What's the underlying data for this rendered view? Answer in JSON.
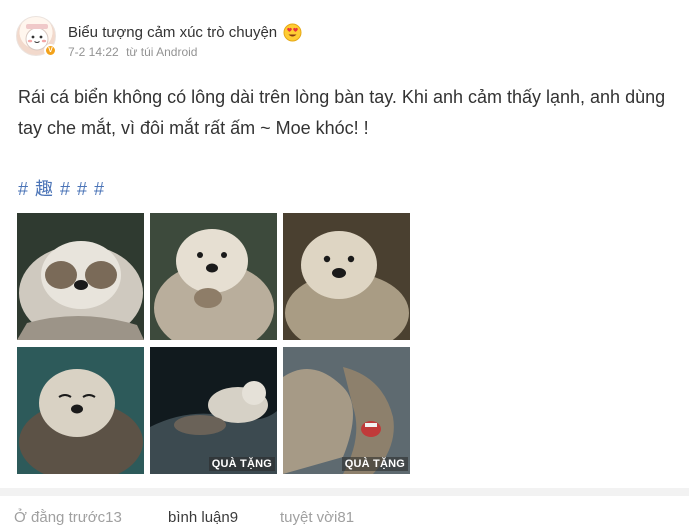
{
  "author": {
    "name": "Biểu tượng cảm xúc trò chuyện",
    "badge_icon": "heart-eyes-emoji-icon",
    "verified_icon": "verified-v-icon",
    "verified_color": "#f3a21a"
  },
  "meta": {
    "time": "7-2 14:22",
    "source": "từ túi Android"
  },
  "content": {
    "text": "Rái cá biển không có lông dài trên lòng bàn tay. Khi anh cảm thấy lạnh, anh dùng tay che mắt, vì đôi mắt rất ấm ~ Moe khóc! !",
    "hashtag": "# 趣 # # #",
    "hashtag_color": "#4b74b7"
  },
  "images": [
    {
      "name": "otter-covering-eyes",
      "badge": ""
    },
    {
      "name": "otter-paws-together",
      "badge": ""
    },
    {
      "name": "otter-looking-up",
      "badge": ""
    },
    {
      "name": "otter-eyes-closed",
      "badge": ""
    },
    {
      "name": "otter-floating-on-back",
      "badge": "QUÀ TẶNG"
    },
    {
      "name": "otter-stretching",
      "badge": "QUÀ TẶNG"
    }
  ],
  "footer": {
    "repost": "Ở đằng trước13",
    "comment": "bình luận9",
    "like": "tuyệt vời81"
  }
}
